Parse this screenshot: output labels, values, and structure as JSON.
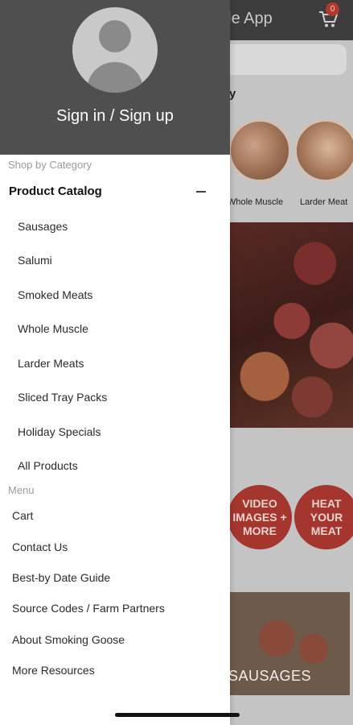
{
  "background_app": {
    "title_fragment": "sale App",
    "cart_badge": "0",
    "section_fragment": "ory",
    "categories": [
      "Whole Muscle",
      "Larder Meat"
    ],
    "promo_buttons": [
      "VIDEO IMAGES + MORE",
      "HEAT YOUR MEAT"
    ],
    "banner_label": "SAUSAGES",
    "icons": {
      "cart": "cart-icon"
    }
  },
  "drawer": {
    "signin_label": "Sign in / Sign up",
    "shop_section_label": "Shop by Category",
    "catalog_title": "Product Catalog",
    "categories": [
      "Sausages",
      "Salumi",
      "Smoked Meats",
      "Whole Muscle",
      "Larder Meats",
      "Sliced Tray Packs",
      "Holiday Specials",
      "All Products"
    ],
    "menu_section_label": "Menu",
    "menu_items": [
      "Cart",
      "Contact Us",
      "Best-by Date Guide",
      "Source Codes / Farm Partners",
      "About Smoking Goose",
      "More Resources"
    ],
    "icons": {
      "avatar": "avatar-icon",
      "collapse": "minus-icon"
    }
  },
  "colors": {
    "drawer_header": "#4f4f4f",
    "accent_red": "#a5362e"
  }
}
